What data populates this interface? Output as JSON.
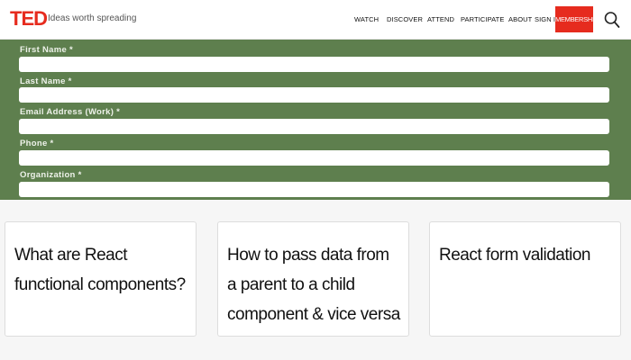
{
  "header": {
    "logo": "TED",
    "tagline": "Ideas worth spreading",
    "nav": {
      "watch": "WATCH",
      "discover": "DISCOVER",
      "attend": "ATTEND",
      "participate": "PARTICIPATE",
      "about": "ABOUT",
      "sign_in": "SIGN IN"
    },
    "membership": "MEMBERSHIP",
    "search_icon": "search-icon",
    "brand_color": "#e62b1e"
  },
  "form": {
    "background_color": "#5e7f4e",
    "fields": {
      "first_name": {
        "label": "First Name *",
        "value": ""
      },
      "last_name": {
        "label": "Last Name *",
        "value": ""
      },
      "email": {
        "label": "Email Address (Work) *",
        "value": ""
      },
      "phone": {
        "label": "Phone *",
        "value": ""
      },
      "organization": {
        "label": "Organization *",
        "value": ""
      }
    }
  },
  "cards": [
    {
      "title": "What are React functional components?"
    },
    {
      "title": "How to pass data from a parent to a child component & vice versa"
    },
    {
      "title": "React form validation"
    }
  ]
}
